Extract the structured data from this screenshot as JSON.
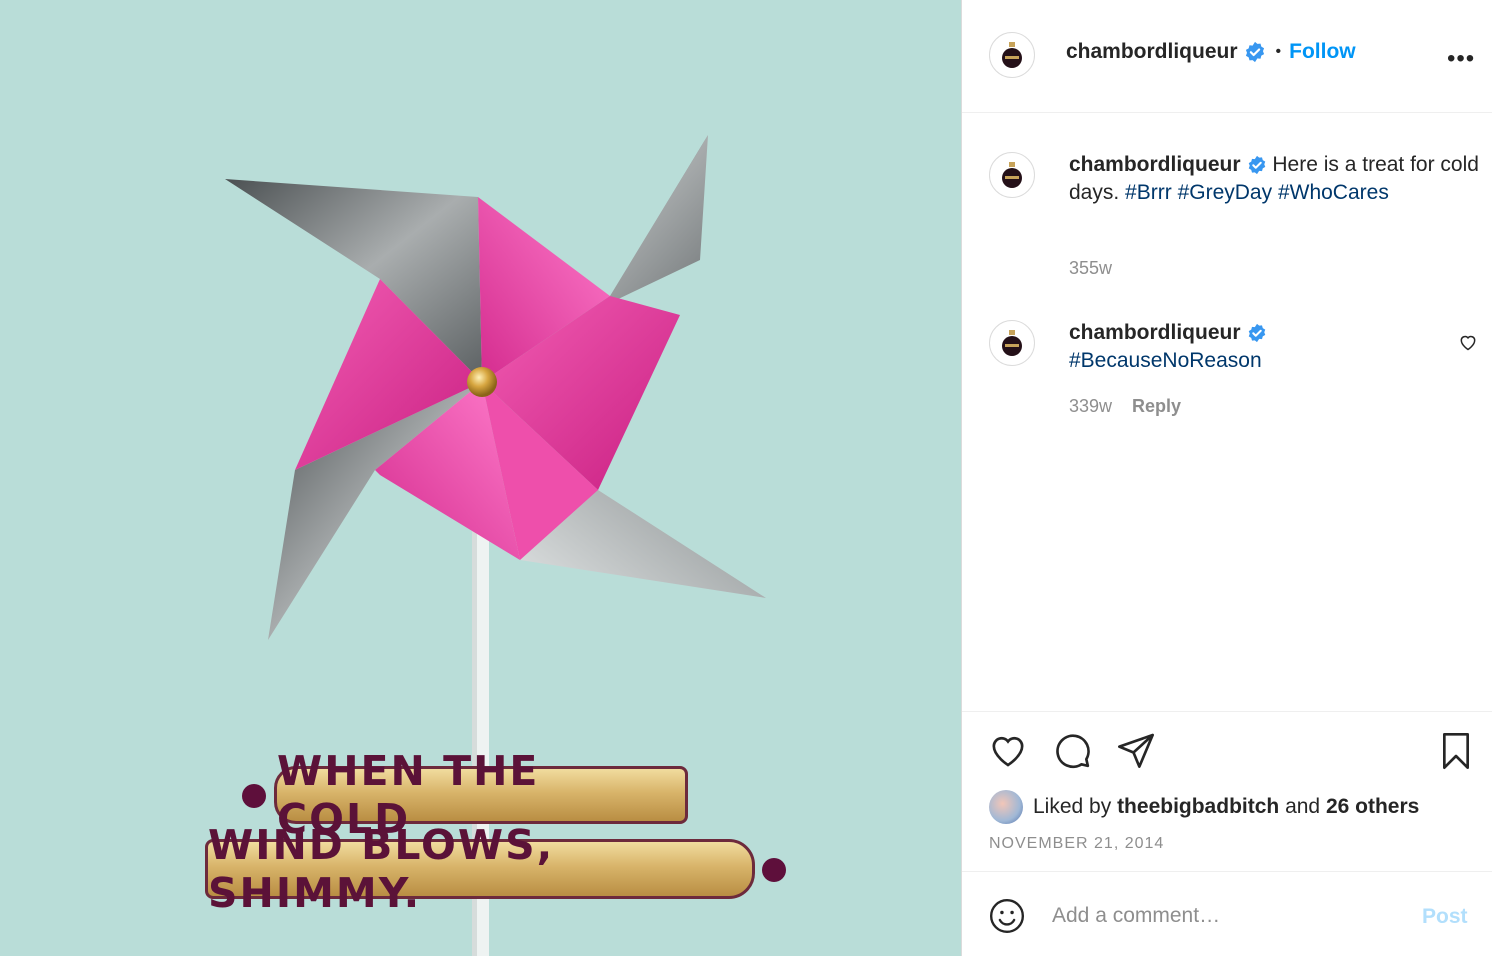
{
  "post": {
    "image_text": {
      "line1": "WHEN THE COLD",
      "line2": "WIND BLOWS, SHIMMY."
    },
    "colors": {
      "background": "#b9ddd8",
      "pinwheel_pink": "#e0389d",
      "pinwheel_grey": "#8a8f90",
      "follow_blue": "#0095f6",
      "hashtag_navy": "#00376b",
      "verified_blue": "#3897f0"
    }
  },
  "header": {
    "username": "chambordliqueur",
    "separator": "•",
    "follow_label": "Follow",
    "more_label": "•••"
  },
  "caption": {
    "username": "chambordliqueur",
    "text": "Here is a treat for cold days.",
    "hashtags": [
      "#Brrr",
      "#GreyDay",
      "#WhoCares"
    ],
    "time": "355w"
  },
  "comment": {
    "username": "chambordliqueur",
    "hashtag": "#BecauseNoReason",
    "time": "339w",
    "reply_label": "Reply"
  },
  "actions": {
    "icons": [
      "heart-icon",
      "comment-icon",
      "share-icon",
      "bookmark-icon"
    ],
    "liked_prefix": "Liked by",
    "liked_user": "theebigbadbitch",
    "liked_and": "and",
    "liked_others": "26 others",
    "date": "NOVEMBER 21, 2014"
  },
  "add_comment": {
    "placeholder": "Add a comment…",
    "post_label": "Post"
  }
}
